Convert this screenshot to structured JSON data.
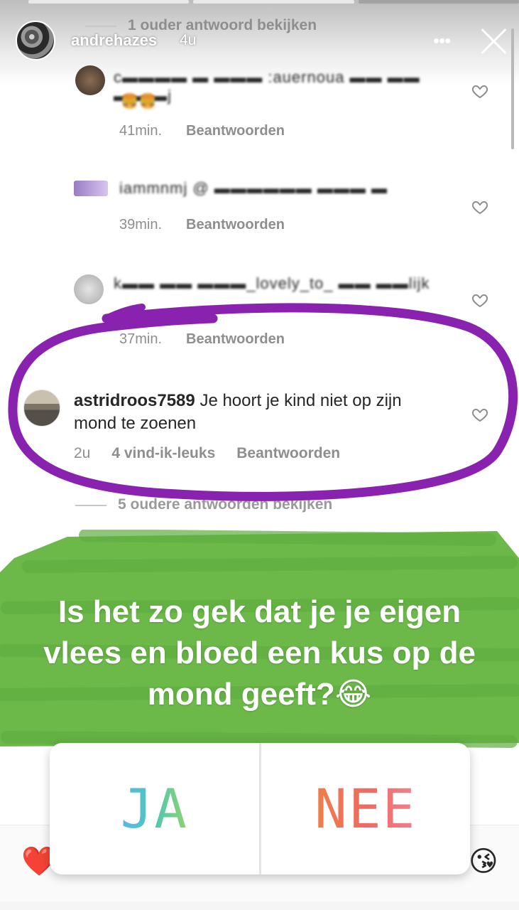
{
  "story": {
    "username": "andrehazes",
    "time": "4u"
  },
  "thread": {
    "view_older_reply": "1 ouder antwoord bekijken",
    "comments_blurred": [
      {
        "time": "41min.",
        "reply": "Beantwoorden"
      },
      {
        "time": "39min.",
        "reply": "Beantwoorden"
      },
      {
        "time": "37min.",
        "reply": "Beantwoorden"
      }
    ],
    "highlighted_comment": {
      "username": "astridroos7589",
      "text": "Je hoort je kind niet op zijn mond te zoenen",
      "time": "2u",
      "likes": "4 vind-ik-leuks",
      "reply": "Beantwoorden"
    },
    "view_older_replies": "5 oudere antwoorden bekijken"
  },
  "question": {
    "line1": "Is het zo gek dat je je eigen",
    "line2": "vlees en bloed een kus op de",
    "line3": "mond geeft?😂"
  },
  "poll": {
    "option_a": "JA",
    "option_b": "NEE"
  },
  "reactions": {
    "left": "❤️",
    "right": "😘"
  },
  "colors": {
    "annotation_circle": "#8a22b0",
    "annotation_green": "#6cb94a",
    "poll_ja_gradient": [
      "#56b7ee",
      "#8ed46a"
    ],
    "poll_nee_gradient": [
      "#f07e47",
      "#f3808b"
    ]
  }
}
